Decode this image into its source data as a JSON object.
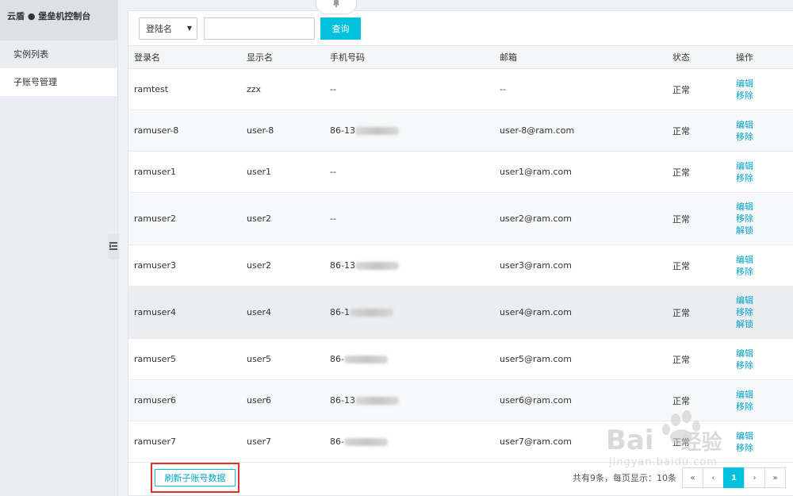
{
  "sidebar": {
    "brand": "云盾 ● 堡垒机控制台",
    "items": [
      {
        "label": "实例列表",
        "active": false
      },
      {
        "label": "子账号管理",
        "active": true
      }
    ]
  },
  "toolbar": {
    "filter_selected": "登陆名",
    "search_value": "",
    "query_label": "查询"
  },
  "table": {
    "columns": [
      "登录名",
      "显示名",
      "手机号码",
      "邮箱",
      "状态",
      "操作"
    ],
    "rows": [
      {
        "login": "ramtest",
        "display": "zzx",
        "phone": "--",
        "email": "--",
        "status": "正常",
        "ops": [
          "编辑",
          "移除"
        ]
      },
      {
        "login": "ramuser-8",
        "display": "user-8",
        "phone": "86-13",
        "email": "user-8@ram.com",
        "status": "正常",
        "ops": [
          "编辑",
          "移除"
        ]
      },
      {
        "login": "ramuser1",
        "display": "user1",
        "phone": "--",
        "email": "user1@ram.com",
        "status": "正常",
        "ops": [
          "编辑",
          "移除"
        ]
      },
      {
        "login": "ramuser2",
        "display": "user2",
        "phone": "--",
        "email": "user2@ram.com",
        "status": "正常",
        "ops": [
          "编辑",
          "移除",
          "解锁"
        ]
      },
      {
        "login": "ramuser3",
        "display": "user2",
        "phone": "86-13",
        "email": "user3@ram.com",
        "status": "正常",
        "ops": [
          "编辑",
          "移除"
        ]
      },
      {
        "login": "ramuser4",
        "display": "user4",
        "phone": "86-1",
        "email": "user4@ram.com",
        "status": "正常",
        "ops": [
          "编辑",
          "移除",
          "解锁"
        ]
      },
      {
        "login": "ramuser5",
        "display": "user5",
        "phone": "86-",
        "email": "user5@ram.com",
        "status": "正常",
        "ops": [
          "编辑",
          "移除"
        ]
      },
      {
        "login": "ramuser6",
        "display": "user6",
        "phone": "86-13",
        "email": "user6@ram.com",
        "status": "正常",
        "ops": [
          "编辑",
          "移除"
        ]
      },
      {
        "login": "ramuser7",
        "display": "user7",
        "phone": "86-",
        "email": "user7@ram.com",
        "status": "正常",
        "ops": [
          "编辑",
          "移除"
        ]
      }
    ]
  },
  "footer": {
    "refresh_label": "刷新子账号数据",
    "summary": "共有9条，每页显示：10条",
    "pager": [
      "«",
      "‹",
      "1",
      "›",
      "»"
    ],
    "current_page": "1"
  },
  "watermark": {
    "logo_text": "Bai",
    "logo_cn": "经验",
    "url": "jingyan.baidu.com"
  },
  "colors": {
    "accent": "#00c1de",
    "link": "#00a2ca",
    "highlight": "#e03030"
  },
  "icons": {
    "bell": "bell-icon",
    "collapse": "list-collapse-icon",
    "select_caret": "caret-down-icon",
    "paw": "baidu-paw-icon"
  }
}
